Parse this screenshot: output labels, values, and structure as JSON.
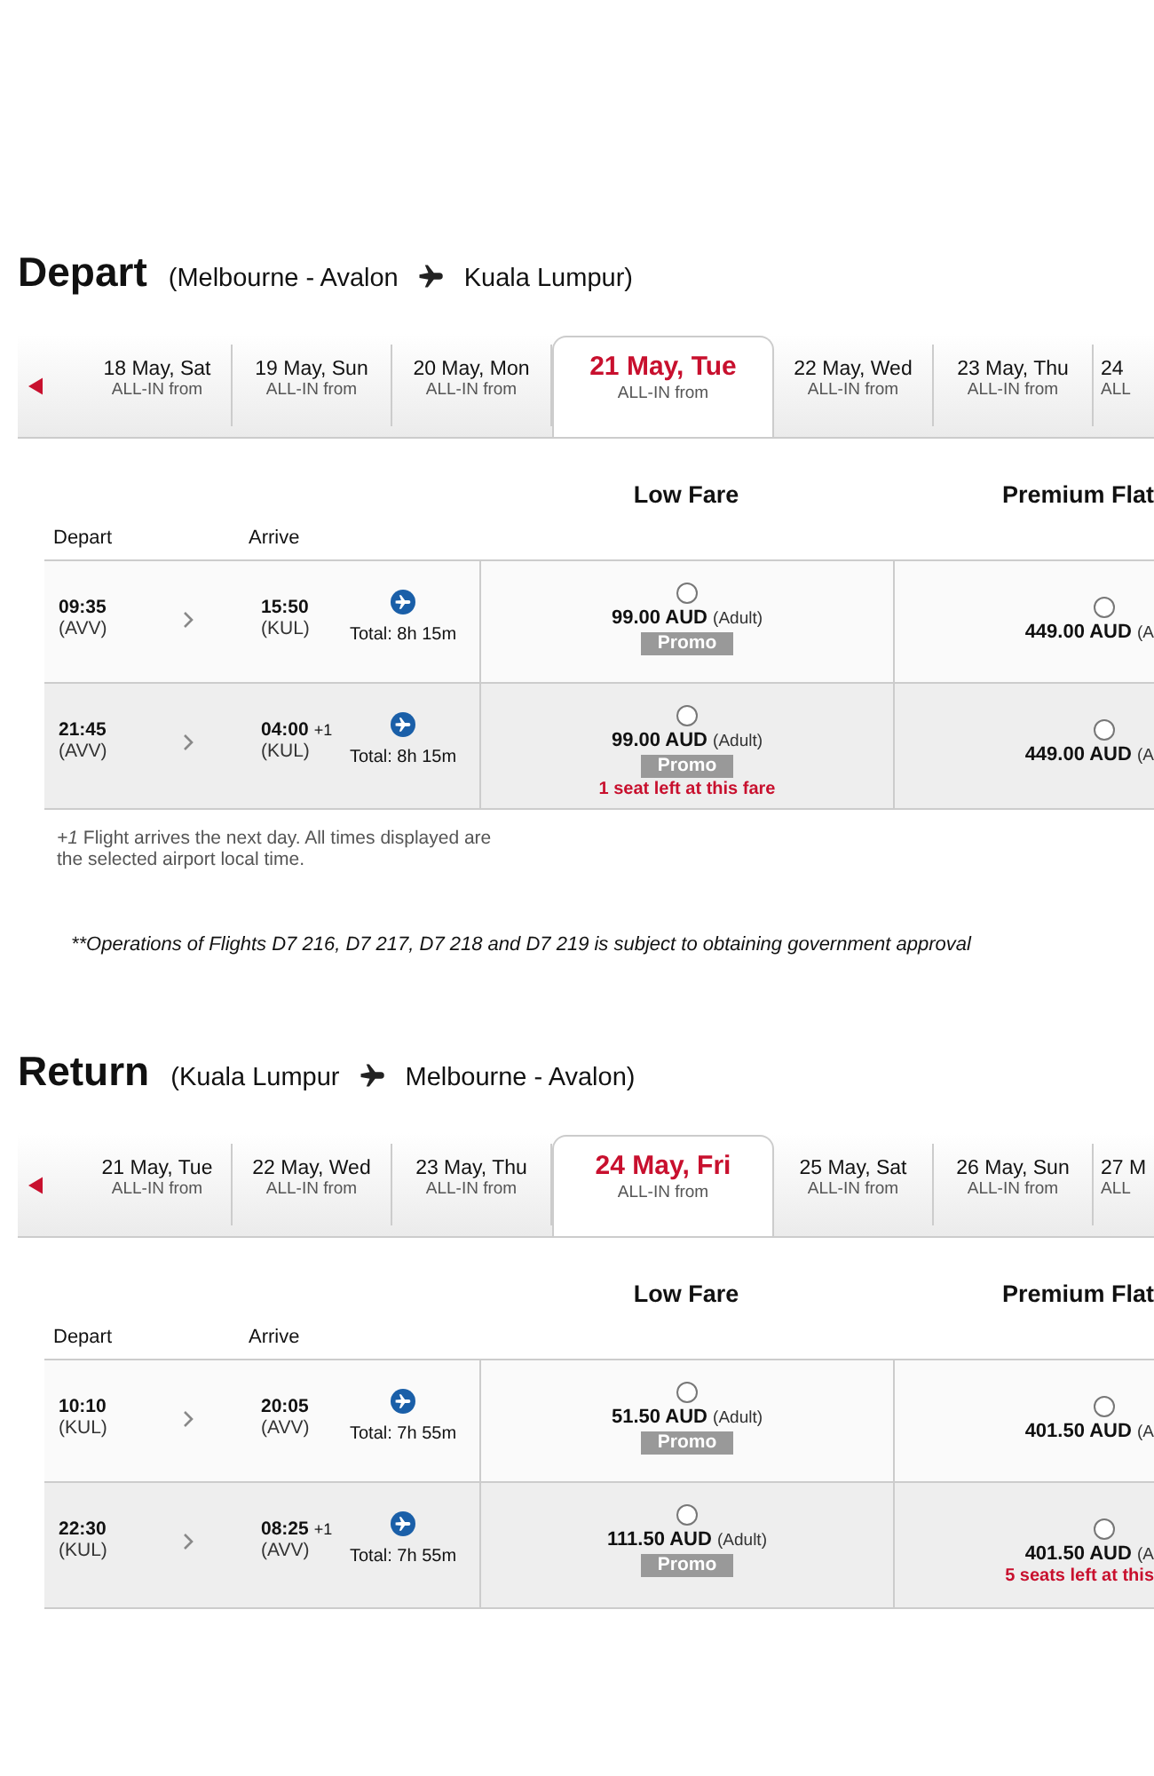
{
  "sections": [
    {
      "title": "Depart",
      "route_from": "(Melbourne - Avalon",
      "route_to": "Kuala Lumpur)",
      "dates": [
        {
          "date": "18 May, Sat",
          "sub": "ALL-IN from",
          "selected": false
        },
        {
          "date": "19 May, Sun",
          "sub": "ALL-IN from",
          "selected": false
        },
        {
          "date": "20 May, Mon",
          "sub": "ALL-IN from",
          "selected": false
        },
        {
          "date": "21 May, Tue",
          "sub": "ALL-IN from",
          "selected": true
        },
        {
          "date": "22 May, Wed",
          "sub": "ALL-IN from",
          "selected": false
        },
        {
          "date": "23 May, Thu",
          "sub": "ALL-IN from",
          "selected": false
        },
        {
          "date": "24",
          "sub": "ALL",
          "selected": false
        }
      ],
      "fare_headers": [
        "Low Fare",
        "Premium Flat"
      ],
      "depart_label": "Depart",
      "arrive_label": "Arrive",
      "flights": [
        {
          "depart_time": "09:35",
          "depart_code": "(AVV)",
          "arrive_time": "15:50",
          "arrive_code": "(KUL)",
          "total": "Total: 8h 15m",
          "fares": [
            {
              "price": "99.00 AUD",
              "unit": "(Adult)",
              "promo": "Promo",
              "selected": false
            },
            {
              "price": "449.00 AUD",
              "unit": "(A",
              "selected": false
            }
          ]
        },
        {
          "depart_time": "21:45",
          "depart_code": "(AVV)",
          "arrive_time": "04:00",
          "next_day": "+1",
          "arrive_code": "(KUL)",
          "total": "Total: 8h 15m",
          "fares": [
            {
              "price": "99.00 AUD",
              "unit": "(Adult)",
              "promo": "Promo",
              "seats_left": "1 seat left at this fare",
              "selected": false
            },
            {
              "price": "449.00 AUD",
              "unit": "(A",
              "selected": false
            }
          ]
        }
      ],
      "note": "*+1* Flight arrives the next day. All times displayed are the selected airport local time.",
      "operations_note": "**Operations of Flights D7 216, D7 217, D7 218 and D7 219 is subject to obtaining government approval"
    },
    {
      "title": "Return",
      "route_from": "(Kuala Lumpur",
      "route_to": "Melbourne - Avalon)",
      "dates": [
        {
          "date": "21 May, Tue",
          "sub": "ALL-IN from",
          "selected": false
        },
        {
          "date": "22 May, Wed",
          "sub": "ALL-IN from",
          "selected": false
        },
        {
          "date": "23 May, Thu",
          "sub": "ALL-IN from",
          "selected": false
        },
        {
          "date": "24 May, Fri",
          "sub": "ALL-IN from",
          "selected": true
        },
        {
          "date": "25 May, Sat",
          "sub": "ALL-IN from",
          "selected": false
        },
        {
          "date": "26 May, Sun",
          "sub": "ALL-IN from",
          "selected": false
        },
        {
          "date": "27 M",
          "sub": "ALL",
          "selected": false
        }
      ],
      "fare_headers": [
        "Low Fare",
        "Premium Flat"
      ],
      "depart_label": "Depart",
      "arrive_label": "Arrive",
      "flights": [
        {
          "depart_time": "10:10",
          "depart_code": "(KUL)",
          "arrive_time": "20:05",
          "arrive_code": "(AVV)",
          "total": "Total: 7h 55m",
          "fares": [
            {
              "price": "51.50 AUD",
              "unit": "(Adult)",
              "promo": "Promo",
              "selected": false
            },
            {
              "price": "401.50 AUD",
              "unit": "(A",
              "selected": false
            }
          ]
        },
        {
          "depart_time": "22:30",
          "depart_code": "(KUL)",
          "arrive_time": "08:25",
          "next_day": "+1",
          "arrive_code": "(AVV)",
          "total": "Total: 7h 55m",
          "fares": [
            {
              "price": "111.50 AUD",
              "unit": "(Adult)",
              "promo": "Promo",
              "selected": false
            },
            {
              "price": "401.50 AUD",
              "unit": "(A",
              "seats_left": "5 seats left at this",
              "selected": false
            }
          ]
        }
      ]
    }
  ]
}
